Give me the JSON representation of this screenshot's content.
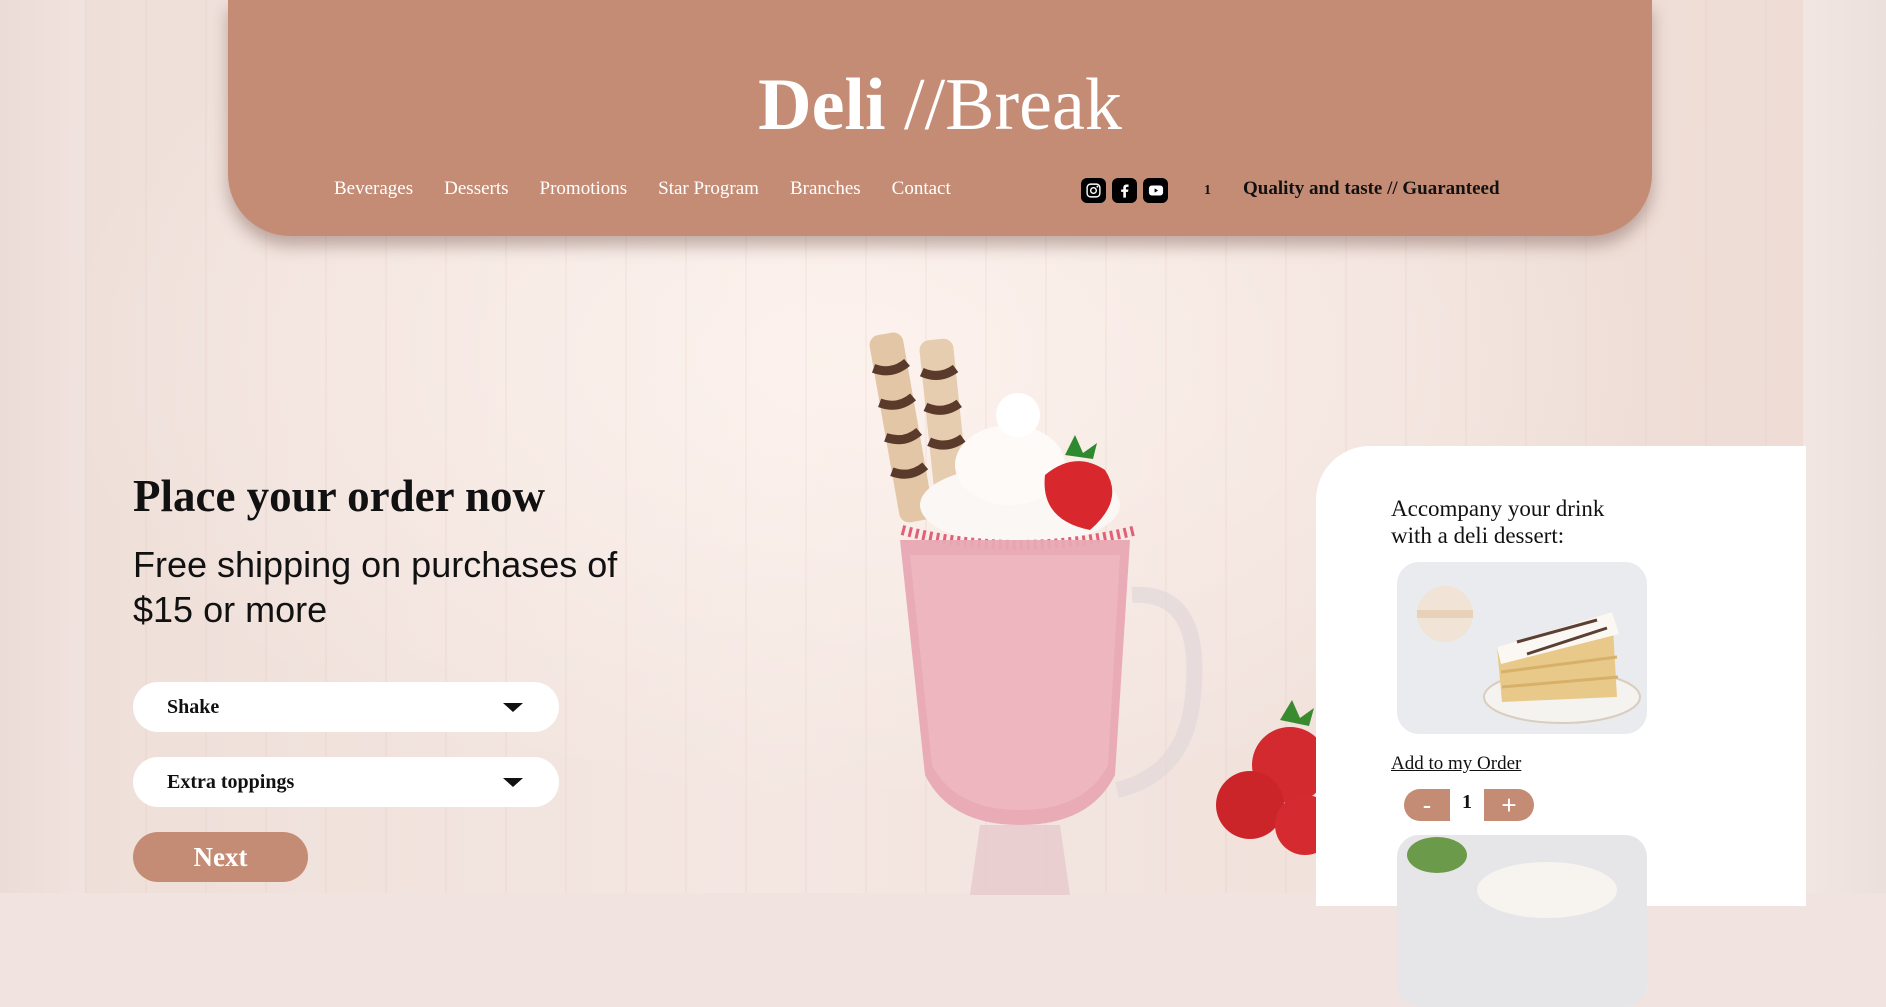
{
  "brand": {
    "bold": "Deli",
    "rest": " //Break"
  },
  "nav": [
    "Beverages",
    "Desserts",
    "Promotions",
    "Star Program",
    "Branches",
    "Contact"
  ],
  "socials": [
    "instagram-icon",
    "facebook-icon",
    "youtube-icon"
  ],
  "cart_count": "1",
  "tagline": "Quality and taste // Guaranteed",
  "order": {
    "title": "Place your order now",
    "subtitle": "Free shipping on purchases of $15 or more",
    "select_drink": "Shake",
    "select_toppings": "Extra toppings",
    "next_label": "Next"
  },
  "sidebar": {
    "heading": "Accompany your drink with a deli dessert:",
    "add_label": "Add to my Order",
    "minus": "-",
    "quantity": "1",
    "plus": "+"
  },
  "colors": {
    "accent": "#c48c75",
    "background": "#f1e4e0",
    "card": "#ffffff"
  }
}
